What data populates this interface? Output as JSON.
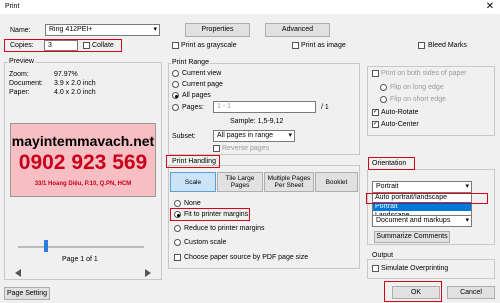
{
  "window": {
    "title": "Print",
    "close": "✕"
  },
  "printer": {
    "name_label": "Name:",
    "name_value": "Ring 412PEI+",
    "properties": "Properties",
    "advanced": "Advanced",
    "copies_label": "Copies:",
    "copies_value": "3",
    "collate": "Collate",
    "grayscale": "Print as grayscale",
    "as_image": "Print as image",
    "bleed_marks": "Bleed Marks"
  },
  "preview": {
    "title": "Preview",
    "zoom_label": "Zoom:",
    "zoom_value": "97.97%",
    "doc_label": "Document:",
    "doc_value": "3.9 x 2.0 inch",
    "paper_label": "Paper:",
    "paper_value": "4.0 x 2.0 inch",
    "label_url": "mayintemmavach.net",
    "label_phone": "0902 923 569",
    "label_address": "33/1 Hoang Diệu, P.10, Q.PN, HCM",
    "page_text": "Page 1 of 1"
  },
  "print_range": {
    "title": "Print Range",
    "current_view": "Current view",
    "current_page": "Current page",
    "all_pages": "All pages",
    "pages": "Pages:",
    "pages_value": "1 - 1",
    "pages_total": "/ 1",
    "sample": "Sample: 1,5-9,12",
    "subset_label": "Subset:",
    "subset_value": "All pages in range",
    "reverse": "Reverse pages"
  },
  "handling": {
    "title": "Print Handling",
    "tabs": [
      "Scale",
      "Tile Large Pages",
      "Multiple Pages Per Sheet",
      "Booklet"
    ],
    "none": "None",
    "fit": "Fit to printer margins",
    "reduce": "Reduce to printer margins",
    "custom": "Custom scale",
    "choose_source": "Choose paper source by PDF page size"
  },
  "right": {
    "both_sides": "Print on both sides of paper",
    "long_edge": "Flip on long edge",
    "short_edge": "Flip on short edge",
    "auto_rotate": "Auto-Rotate",
    "auto_center": "Auto-Center",
    "orientation_title": "Orientation",
    "orientation_value": "Portrait",
    "options": [
      "Auto portrait/landscape",
      "Portrait",
      "Landscape"
    ],
    "comments_value": "Document and markups",
    "summarize": "Summarize Comments",
    "output_title": "Output",
    "simulate": "Simulate Overprinting"
  },
  "footer": {
    "page_setting": "Page Setting",
    "ok": "OK",
    "cancel": "Cancel"
  }
}
